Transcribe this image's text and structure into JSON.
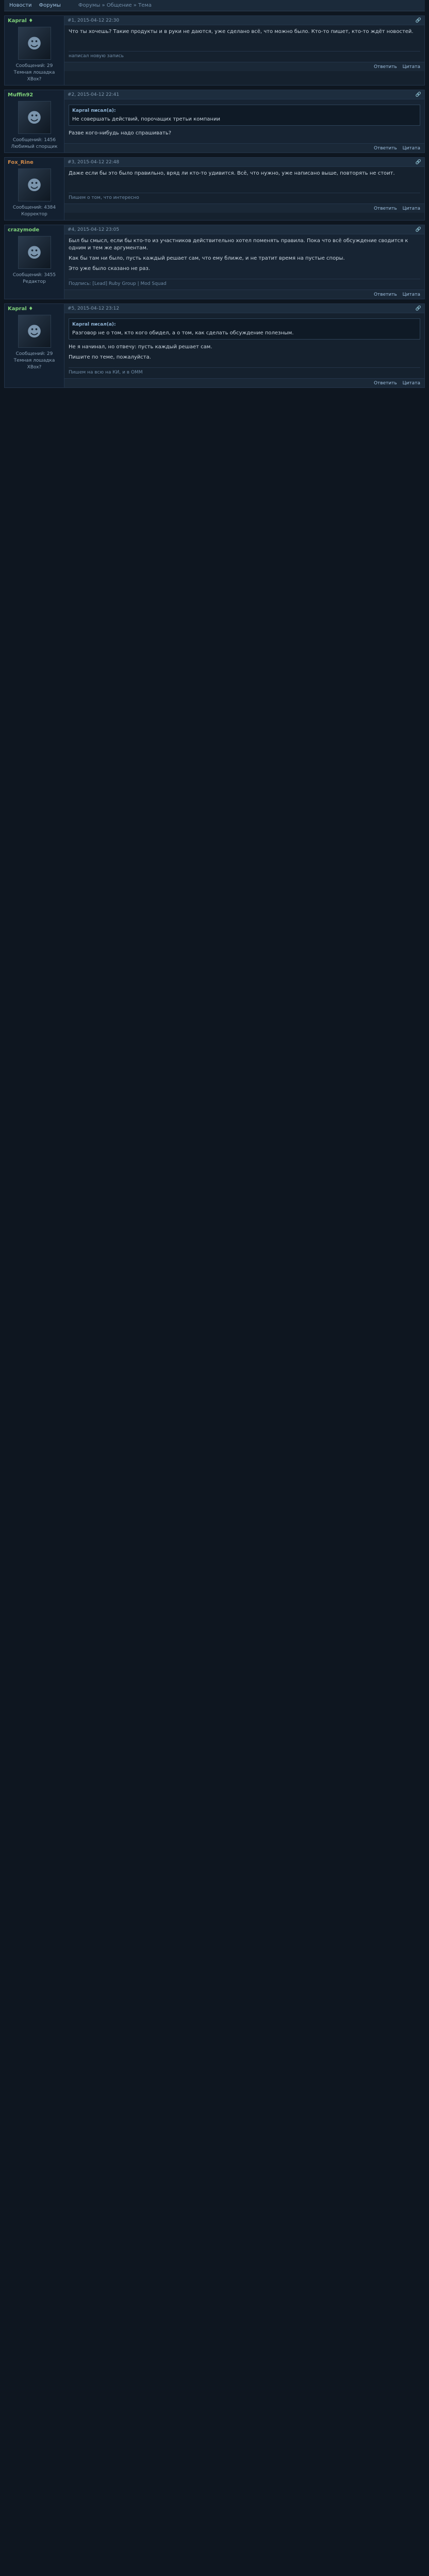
{
  "nav": {
    "items": [
      "Новости",
      "Форумы"
    ],
    "breadcrumb": "Форумы » Общение » Тема"
  },
  "posts": [
    {
      "user": "Kapral ♦",
      "online": true,
      "posts_label": "Сообщений: 29",
      "rank": "Темная лошадка XBox?",
      "date": "#1, 2015-04-12 22:30",
      "quote_author": "",
      "quote_text": "",
      "paragraphs": [
        "Что ты хочешь? Такие продукты и в руки не даются, уже сделано всё, что можно было. Кто-то пишет, кто-то ждёт новостей."
      ],
      "signature": "написал новую запись"
    },
    {
      "user": "Muffin92",
      "online": true,
      "posts_label": "Сообщений: 1456",
      "rank": "Любимый спорщик",
      "date": "#2, 2015-04-12 22:41",
      "quote_author": "Kapral писал(а):",
      "quote_text": "Не совершать действий, порочащих третьи компании",
      "paragraphs": [
        "Разве кого-нибудь надо спрашивать?"
      ],
      "signature": ""
    },
    {
      "user": "Fox_Rine",
      "online": false,
      "posts_label": "Сообщений: 4384",
      "rank": "Корректор",
      "date": "#3, 2015-04-12 22:48",
      "quote_author": "",
      "quote_text": "",
      "paragraphs": [
        "Даже если бы это было правильно, вряд ли кто-то удивится. Всё, что нужно, уже написано выше, повторять не стоит."
      ],
      "signature": "Пишем о том, что интересно"
    },
    {
      "user": "crazymode",
      "online": true,
      "posts_label": "Сообщений: 3455",
      "rank": "Редактор",
      "date": "#4, 2015-04-12 23:05",
      "quote_author": "",
      "quote_text": "",
      "paragraphs": [
        "Был бы смысл, если бы кто-то из участников действительно хотел поменять правила. Пока что всё обсуждение сводится к одним и тем же аргументам.",
        "Как бы там ни было, пусть каждый решает сам, что ему ближе, и не тратит время на пустые споры.",
        "Это уже было сказано не раз."
      ],
      "signature": "Подпись: [Lead] Ruby Group | Mod Squad"
    },
    {
      "user": "Kapral ♦",
      "online": true,
      "posts_label": "Сообщений: 29",
      "rank": "Темная лошадка XBox?",
      "date": "#5, 2015-04-12 23:12",
      "quote_author": "Kapral писал(а):",
      "quote_text": "Разговор не о том, кто кого обидел, а о том, как сделать обсуждение полезным.",
      "paragraphs": [
        "Не я начинал, но отвечу: пусть каждый решает сам.",
        "Пишите по теме, пожалуйста."
      ],
      "signature": "Пишем на всю на КИ, и в ОММ"
    }
  ],
  "footer": {
    "reply": "Ответить",
    "quote": "Цитата"
  }
}
